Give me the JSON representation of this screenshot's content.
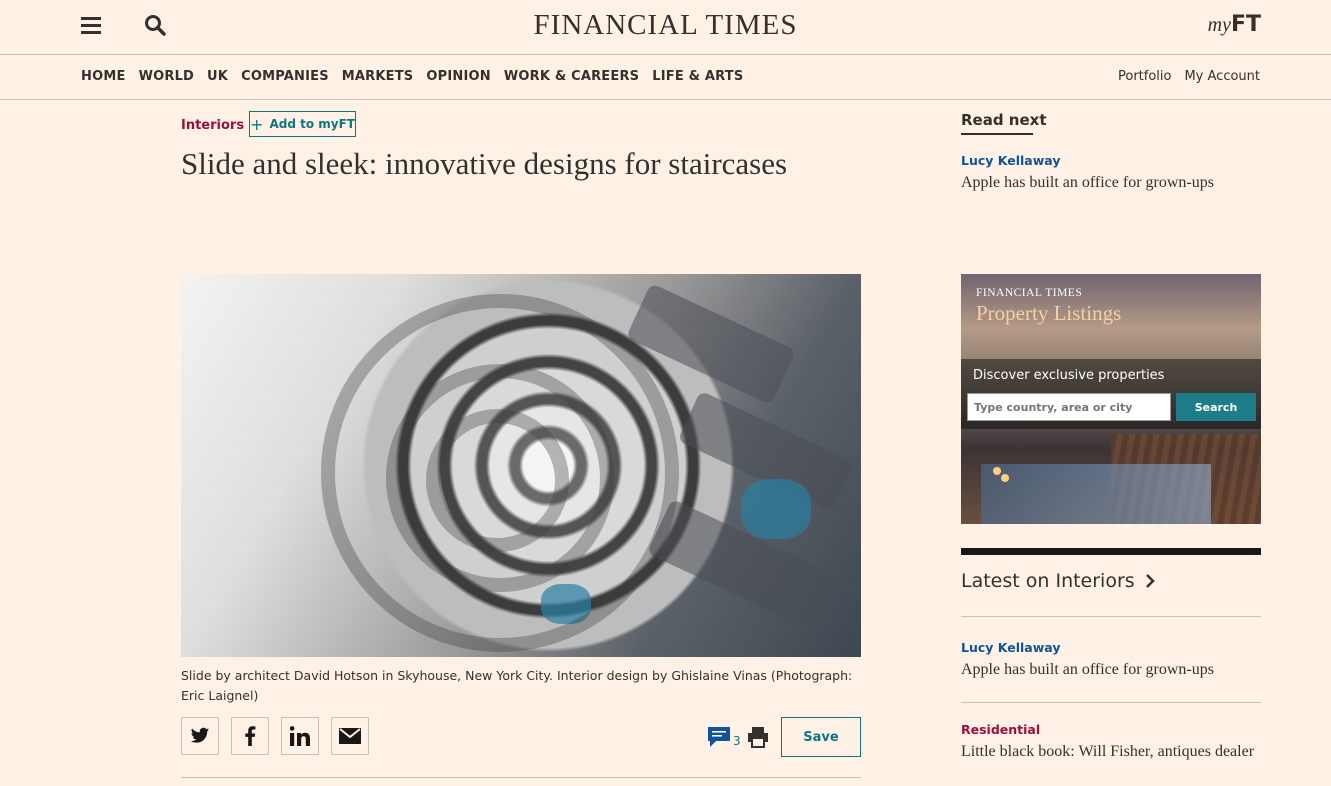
{
  "header": {
    "logo": "FINANCIAL TIMES",
    "myft_prefix": "my",
    "myft_suffix": "FT",
    "icons": [
      "menu-icon",
      "search-icon"
    ]
  },
  "nav": {
    "items": [
      "HOME",
      "WORLD",
      "UK",
      "COMPANIES",
      "MARKETS",
      "OPINION",
      "WORK & CAREERS",
      "LIFE & ARTS"
    ],
    "right": [
      "Portfolio",
      "My Account"
    ]
  },
  "article": {
    "topic": "Interiors",
    "add_myft": "Add to myFT",
    "headline": "Slide and sleek: innovative designs for staircases",
    "caption": "Slide by architect David Hotson in Skyhouse, New York City. Interior design by Ghislaine Vinas (Photograph: Eric Laignel)",
    "share_icons": [
      "twitter-icon",
      "facebook-icon",
      "linkedin-icon",
      "email-icon"
    ],
    "comment_count": "3",
    "save_label": "Save"
  },
  "sidebar": {
    "read_next_title": "Read next",
    "read_next": {
      "author": "Lucy Kellaway",
      "title": "Apple has built an office for grown-ups"
    },
    "ad": {
      "brand": "FINANCIAL TIMES",
      "product": "Property Listings",
      "tagline": "Discover exclusive properties",
      "placeholder": "Type country, area or city",
      "button": "Search"
    },
    "latest_title": "Latest on Interiors",
    "latest": [
      {
        "label": "Lucy Kellaway",
        "title": "Apple has built an office for grown-ups"
      },
      {
        "label": "Residential",
        "title": "Little black book: Will Fisher, antiques dealer"
      }
    ]
  },
  "colors": {
    "background": "#fff1e5",
    "claret": "#990f3d",
    "teal": "#0d7680",
    "oxford": "#0f5499",
    "text": "#33302e"
  }
}
